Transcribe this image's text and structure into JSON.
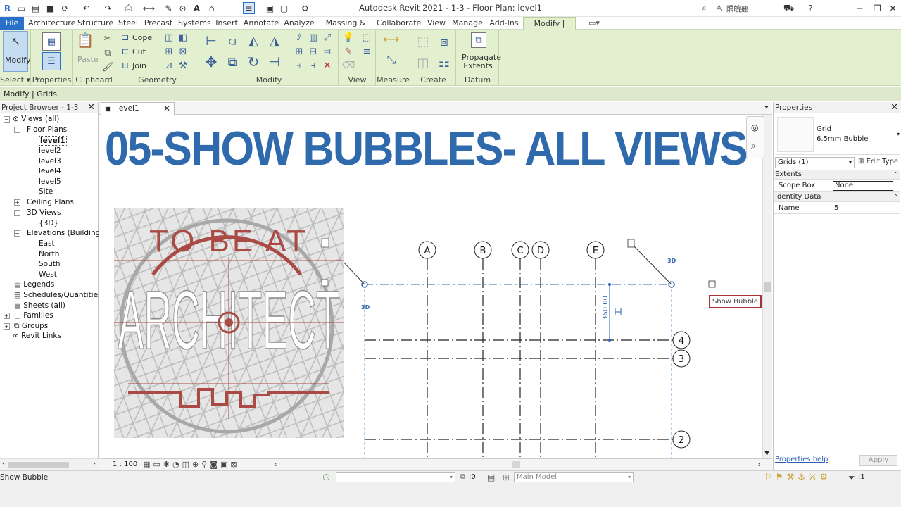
{
  "app": {
    "title": "Autodesk Revit 2021 - 1-3 - Floor Plan: level1",
    "user": "隅皖翹"
  },
  "tabs": [
    "File",
    "Architecture",
    "Structure",
    "Steel",
    "Precast",
    "Systems",
    "Insert",
    "Annotate",
    "Analyze",
    "Massing & Site",
    "Collaborate",
    "View",
    "Manage",
    "Add-Ins",
    "Modify | Grids"
  ],
  "ribbon": {
    "panels": [
      "Select",
      "Properties",
      "Clipboard",
      "Geometry",
      "Modify",
      "View",
      "Measure",
      "Create",
      "Datum"
    ],
    "modify": "Modify",
    "paste": "Paste",
    "cope": "Cope",
    "cut": "Cut",
    "join": "Join",
    "propagate": [
      "Propagate",
      "Extents"
    ]
  },
  "context_bar": "Modify | Grids",
  "project_browser": {
    "title": "Project Browser - 1-3",
    "items": [
      "Views (all)",
      "Floor Plans",
      "level1",
      "level2",
      "level3",
      "level4",
      "level5",
      "Site",
      "Ceiling Plans",
      "3D Views",
      "{3D}",
      "Elevations (Building El",
      "East",
      "North",
      "South",
      "West",
      "Legends",
      "Schedules/Quantities (a",
      "Sheets (all)",
      "Families",
      "Groups",
      "Revit Links"
    ]
  },
  "view": {
    "tab": "level1",
    "headline": "05-SHOW BUBBLES- ALL VIEWS",
    "logo_text": [
      "TO BE AT",
      "ARCHITECT"
    ],
    "grid_columns": [
      "A",
      "B",
      "C",
      "D",
      "E"
    ],
    "grid_rows": [
      "4",
      "3",
      "2"
    ],
    "threed_label": "3D",
    "dimension": "360.00",
    "tooltip": "Show Bubble",
    "scale": "1 : 100"
  },
  "properties": {
    "title": "Properties",
    "family": "Grid",
    "type": "6.5mm Bubble",
    "selector": "Grids (1)",
    "edit_type": "Edit Type",
    "sections": [
      "Extents",
      "Identity Data"
    ],
    "scope_box_label": "Scope Box",
    "scope_box_value": "None",
    "name_label": "Name",
    "name_value": "5",
    "help": "Properties help",
    "apply": "Apply"
  },
  "status": {
    "text": "Show Bubble",
    "model": "Main Model",
    "count": ":0",
    "filter": ":1"
  },
  "colors": {
    "headline": "#2f6aac",
    "ribbon": "#e3f0d0",
    "file_tab": "#2a6fc9",
    "grid_select": "#2e63b0",
    "logo_red": "#a94a44"
  }
}
